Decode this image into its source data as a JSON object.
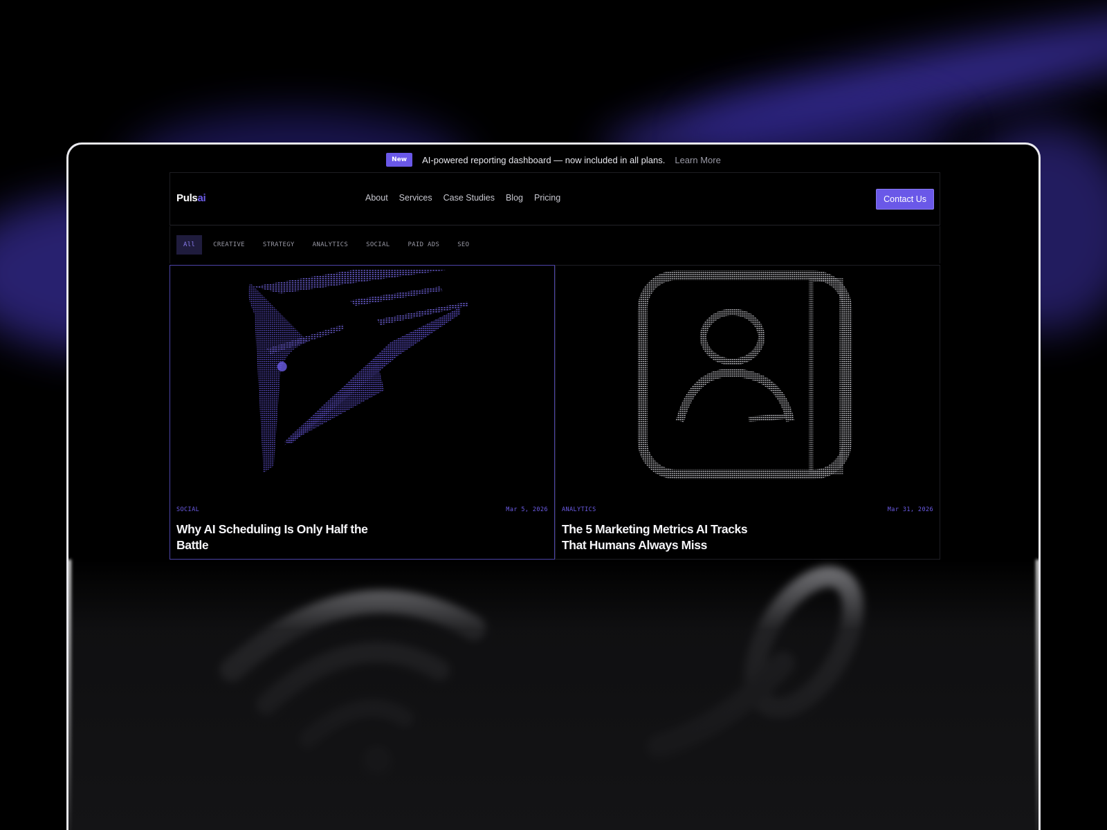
{
  "announcement": {
    "badge": "New",
    "text": "AI-powered reporting dashboard — now included in all plans.",
    "link": "Learn More"
  },
  "nav": {
    "logo_main": "Puls",
    "logo_accent": "ai",
    "items": [
      "About",
      "Services",
      "Case Studies",
      "Blog",
      "Pricing"
    ],
    "cta": "Contact Us"
  },
  "filters": {
    "items": [
      "All",
      "CREATIVE",
      "STRATEGY",
      "ANALYTICS",
      "SOCIAL",
      "PAID ADS",
      "SEO"
    ],
    "active": "All"
  },
  "cards": [
    {
      "category": "SOCIAL",
      "date": "Mar 5, 2026",
      "title": "Why AI Scheduling Is Only Half the Battle",
      "art_icon": "send-plane-icon",
      "accent": "#6c5ce7"
    },
    {
      "category": "ANALYTICS",
      "date": "Mar 31, 2026",
      "title": "The 5 Marketing Metrics AI Tracks That Humans Always Miss",
      "art_icon": "user-profile-icon",
      "accent": "#d8d8d8"
    }
  ],
  "lower_cards": [
    {
      "art_icon": "wifi-icon"
    },
    {
      "art_icon": "ring-icon"
    }
  ],
  "colors": {
    "accent": "#6a58e8",
    "background": "#000000",
    "frame": "#e9e9ee"
  }
}
